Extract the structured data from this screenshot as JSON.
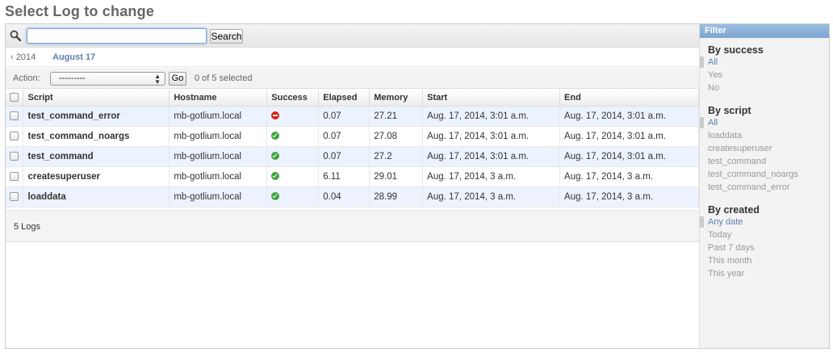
{
  "page_title": "Select Log to change",
  "search": {
    "value": "",
    "placeholder": "",
    "button_label": "Search"
  },
  "date_hierarchy": {
    "back_label": "‹ 2014",
    "current_label": "August 17"
  },
  "actions": {
    "label": "Action:",
    "selected": "---------",
    "go_label": "Go",
    "selection_text": "0 of 5 selected"
  },
  "table": {
    "columns": [
      "Script",
      "Hostname",
      "Success",
      "Elapsed",
      "Memory",
      "Start",
      "End"
    ],
    "rows": [
      {
        "script": "test_command_error",
        "hostname": "mb-gotlium.local",
        "success": "error-icon",
        "elapsed": "0.07",
        "memory": "27.21",
        "start": "Aug. 17, 2014, 3:01 a.m.",
        "end": "Aug. 17, 2014, 3:01 a.m."
      },
      {
        "script": "test_command_noargs",
        "hostname": "mb-gotlium.local",
        "success": "check-icon",
        "elapsed": "0.07",
        "memory": "27.08",
        "start": "Aug. 17, 2014, 3:01 a.m.",
        "end": "Aug. 17, 2014, 3:01 a.m."
      },
      {
        "script": "test_command",
        "hostname": "mb-gotlium.local",
        "success": "check-icon",
        "elapsed": "0.07",
        "memory": "27.2",
        "start": "Aug. 17, 2014, 3:01 a.m.",
        "end": "Aug. 17, 2014, 3:01 a.m."
      },
      {
        "script": "createsuperuser",
        "hostname": "mb-gotlium.local",
        "success": "check-icon",
        "elapsed": "6.11",
        "memory": "29.01",
        "start": "Aug. 17, 2014, 3 a.m.",
        "end": "Aug. 17, 2014, 3 a.m."
      },
      {
        "script": "loaddata",
        "hostname": "mb-gotlium.local",
        "success": "check-icon",
        "elapsed": "0.04",
        "memory": "28.99",
        "start": "Aug. 17, 2014, 3 a.m.",
        "end": "Aug. 17, 2014, 3 a.m."
      }
    ]
  },
  "paginator": {
    "text": "5 Logs"
  },
  "filter": {
    "header": "Filter",
    "groups": [
      {
        "title": "By success",
        "items": [
          "All",
          "Yes",
          "No"
        ],
        "selected": 0
      },
      {
        "title": "By script",
        "items": [
          "All",
          "loaddata",
          "createsuperuser",
          "test_command",
          "test_command_noargs",
          "test_command_error"
        ],
        "selected": 0
      },
      {
        "title": "By created",
        "items": [
          "Any date",
          "Today",
          "Past 7 days",
          "This month",
          "This year"
        ],
        "selected": 0
      }
    ]
  },
  "colors": {
    "link": "#5b80b2",
    "row_alt": "#edf3fe",
    "filter_header": "#7ea6d2",
    "success": "#3fa43f",
    "error": "#d9201a"
  }
}
